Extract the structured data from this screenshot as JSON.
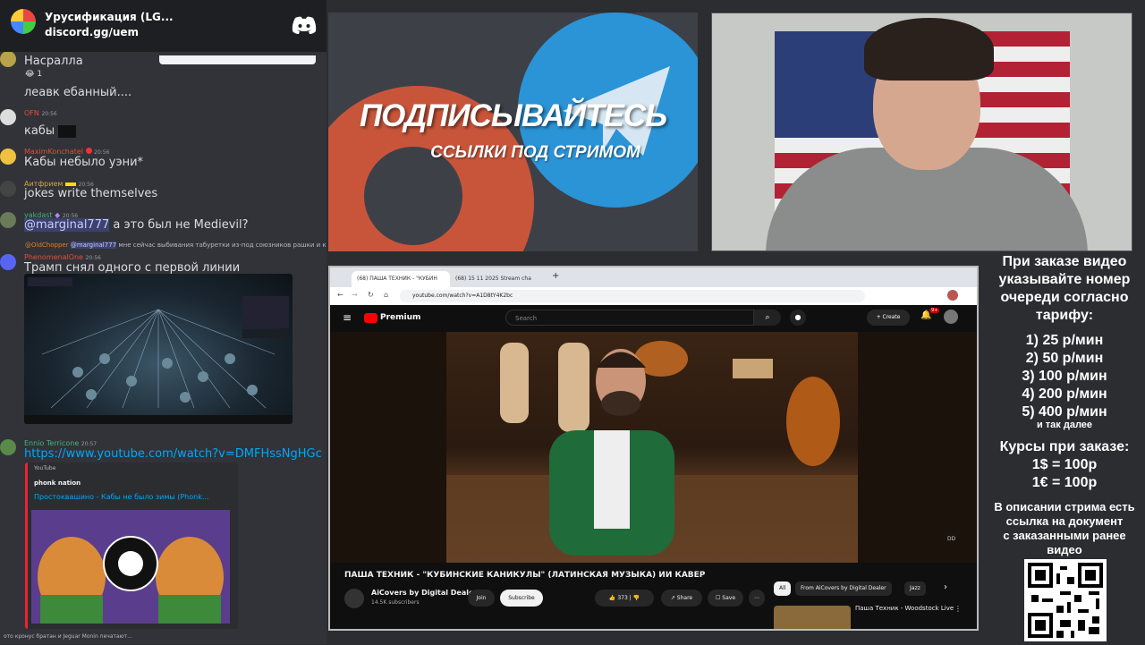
{
  "server": {
    "name": "Урусификация (LG...",
    "invite": "discord.gg/uem"
  },
  "messages": [
    {
      "text": "Насралла",
      "reaction": "1"
    },
    {
      "text": "леавк ебанный...."
    },
    {
      "user": "OFN",
      "time": "20:56",
      "text": "кабы"
    },
    {
      "user": "MaximKonchatel",
      "time": "20:56",
      "text": "Кабы небыло уэни*"
    },
    {
      "user": "Аитфрием",
      "time": "20:56",
      "text": "jokes write themselves"
    },
    {
      "user": "yakdast",
      "time": "20:56",
      "mention": "@marginal777",
      "text": " а это был не Medievil?"
    },
    {
      "reply_user": "@OldChopper",
      "reply_mention": "@marginal777",
      "reply_text": " мне сейчас выбивания табуретки из-под союзников рашки и китая",
      "user": "PhenomenalOne",
      "time": "20:56",
      "text": "Трамп снял одного с первой линии"
    },
    {
      "user": "Ennio Terricone",
      "time": "20:57",
      "text": "https://www.youtube.com/watch?v=DMFHssNgHGc"
    }
  ],
  "embed": {
    "provider": "YouTube",
    "author": "phonk nation",
    "title": "Простоквашино - Кабы не было зимы (Phonk..."
  },
  "typing": "ото кронус братан и Jeguar Monin печатают...",
  "banner": {
    "title": "ПОДПИСЫВАЙТЕСЬ",
    "subtitle": "ССЫЛКИ ПОД СТРИМОМ"
  },
  "browser": {
    "tabs": [
      "(68) ПАША ТЕХНИК - \"КУБИН",
      "(68) 15 11 2025 Stream cha"
    ],
    "url": "youtube.com/watch?v=A1D8tY4K2bc",
    "premium_label": "Premium",
    "search_placeholder": "Search",
    "create_label": "Create",
    "notif_count": "9+",
    "video_title": "ПАША ТЕХНИК - \"КУБИНСКИЕ КАНИКУЛЫ\" (ЛАТИНСКАЯ МУЗЫКА) ИИ КАВЕР",
    "channel": "AiCovers by Digital Dealer",
    "subscribers": "14.5K subscribers",
    "join": "Join",
    "subscribe": "Subscribe",
    "likes": "373",
    "share": "Share",
    "save": "Save",
    "chips": [
      "All",
      "From AiCovers by Digital Dealer",
      "Jazz"
    ],
    "next_video": "Паша Техник - Woodstock Live"
  },
  "info": {
    "lines": [
      "При заказе видео",
      "указывайте номер",
      "очереди согласно",
      "тарифу:"
    ],
    "tariffs": [
      "1) 25 р/мин",
      "2) 50 р/мин",
      "3) 100 р/мин",
      "4) 200 р/мин",
      "5) 400 р/мин"
    ],
    "etc": "и так далее",
    "rates_title": "Курсы при заказе:",
    "rates": [
      "1$ = 100р",
      "1€ = 100р"
    ],
    "desc": [
      "В описании стрима есть",
      "ссылка на документ",
      "с заказанными ранее",
      "видео"
    ]
  }
}
